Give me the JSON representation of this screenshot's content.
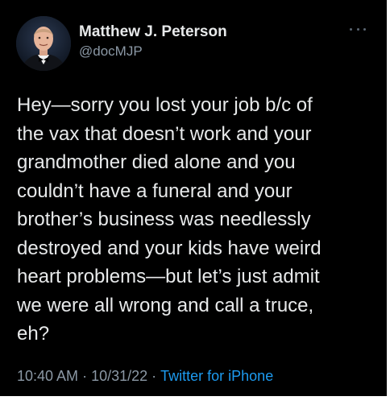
{
  "tweet": {
    "author": {
      "display_name": "Matthew J. Peterson",
      "handle": "@docMJP",
      "avatar_icon": "profile-photo"
    },
    "more_icon": "more-horizontal-icon",
    "text": "Hey—sorry you lost your job b/c of\nthe vax that doesn’t work and your\ngrandmother died alone and you\ncouldn’t have a funeral and your\nbrother’s business was needlessly\ndestroyed and your kids have weird\nheart problems—but let’s just admit\nwe were all wrong and call a truce,\neh?",
    "time": "10:40 AM",
    "separator": "·",
    "date": "10/31/22",
    "source": "Twitter for iPhone"
  },
  "colors": {
    "background": "#000000",
    "text": "#e7e9ea",
    "secondary_text": "#8b98a5",
    "link": "#1d9bf0"
  }
}
